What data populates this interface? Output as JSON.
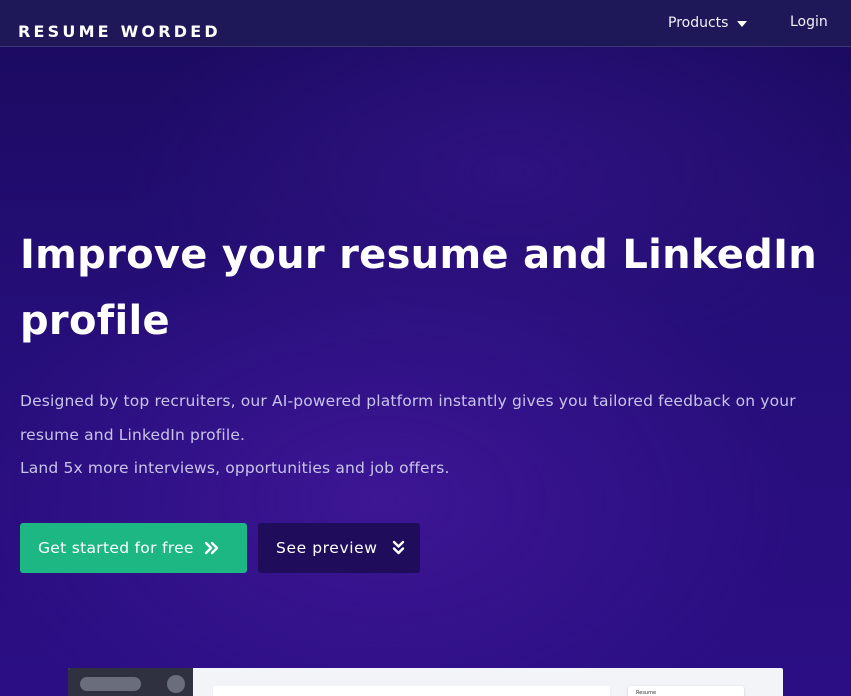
{
  "header": {
    "logo": "RESUME WORDED",
    "nav": {
      "products_label": "Products",
      "login_label": "Login"
    }
  },
  "hero": {
    "title_line1": "Improve your resume and LinkedIn",
    "title_line2": "profile",
    "desc_line1": "Designed by top recruiters, our AI-powered platform instantly gives you tailored feedback on your",
    "desc_line2": "resume and LinkedIn profile.",
    "desc_line3": "Land 5x more interviews, opportunities and job offers.",
    "cta_primary": "Get started for free",
    "cta_secondary": "See preview",
    "cta_primary_icon": "double-chevron-right-icon",
    "cta_secondary_icon": "double-chevron-down-icon"
  },
  "preview": {
    "card_label": "Resume"
  },
  "colors": {
    "brand_green": "#1db784",
    "header_bg": "#1e1858",
    "hero_bg": "#250e78",
    "secondary_button": "#1f0d5c"
  }
}
